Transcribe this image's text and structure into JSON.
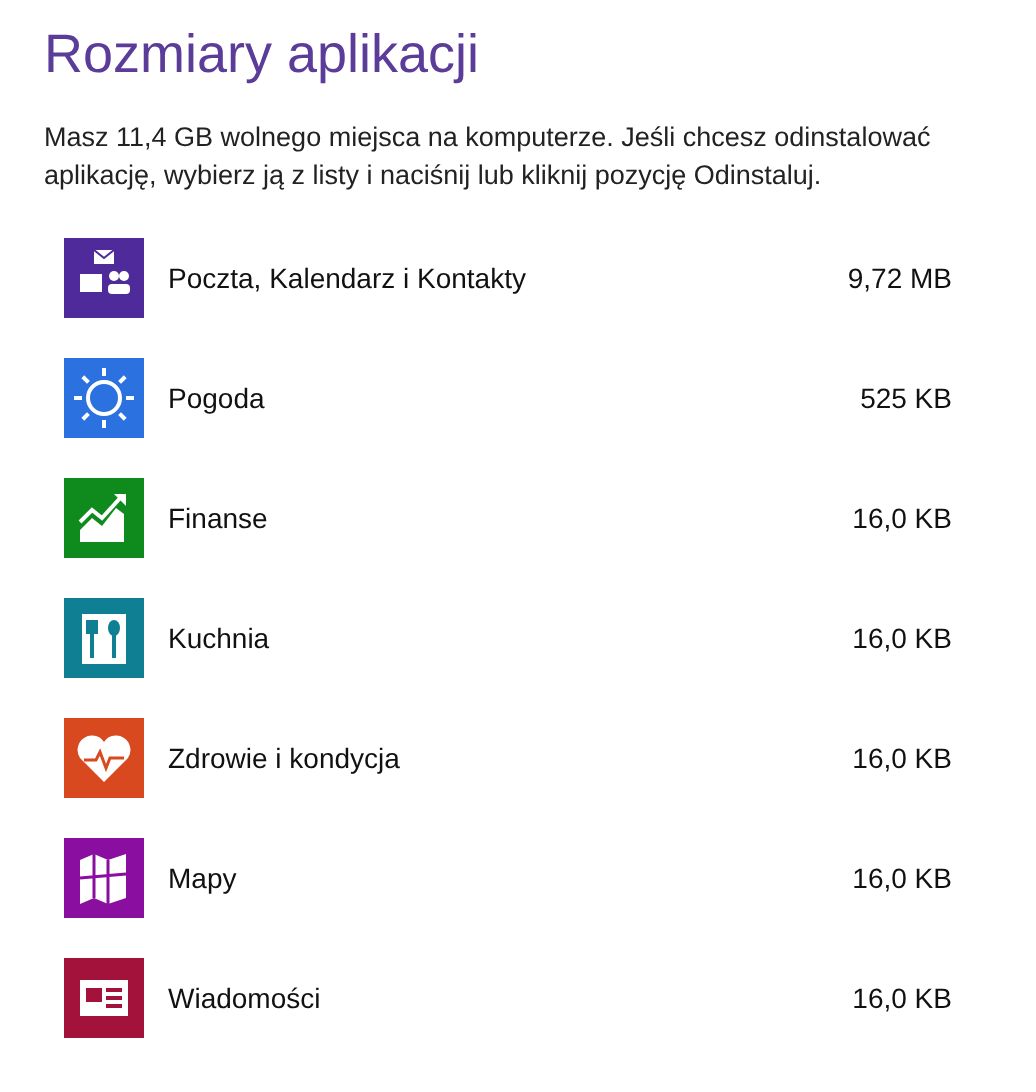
{
  "title": "Rozmiary aplikacji",
  "description": "Masz 11,4 GB wolnego miejsca na komputerze. Jeśli chcesz odinstalować aplikację, wybierz ją z listy i naciśnij lub kliknij pozycję Odinstaluj.",
  "apps": [
    {
      "name": "Poczta, Kalendarz i Kontakty",
      "size": "9,72 MB",
      "kind": "mail",
      "color": "#4e2a9a"
    },
    {
      "name": "Pogoda",
      "size": "525 KB",
      "kind": "weather",
      "color": "#2b72e0"
    },
    {
      "name": "Finanse",
      "size": "16,0 KB",
      "kind": "finance",
      "color": "#0f8a1d"
    },
    {
      "name": "Kuchnia",
      "size": "16,0 KB",
      "kind": "food",
      "color": "#0f7f93"
    },
    {
      "name": "Zdrowie i kondycja",
      "size": "16,0 KB",
      "kind": "health",
      "color": "#d9491f"
    },
    {
      "name": "Mapy",
      "size": "16,0 KB",
      "kind": "maps",
      "color": "#8a0fa0"
    },
    {
      "name": "Wiadomości",
      "size": "16,0 KB",
      "kind": "news",
      "color": "#a3123a"
    }
  ]
}
